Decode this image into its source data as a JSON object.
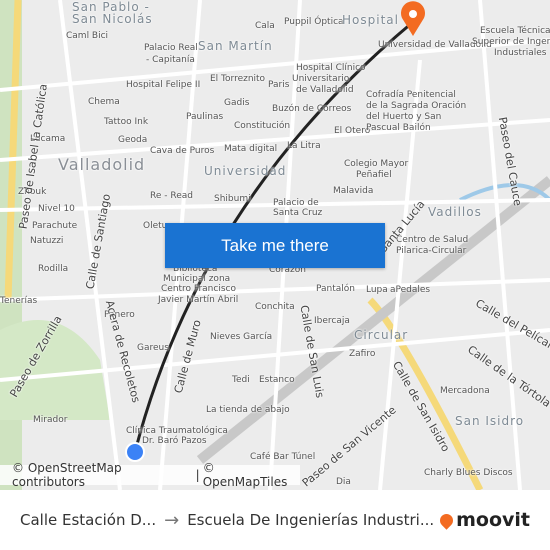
{
  "map": {
    "labels": [
      "San Pablo -",
      "San Nicolás",
      "Caml Bici",
      "Palacio Real",
      "- Capitanía",
      "San Martín",
      "Cala",
      "Puppil Óptica",
      "Hospital",
      "Hospital Felipe II",
      "El Torreznito",
      "Hospital Clínico",
      "Universitario",
      "de Valladolid",
      "Chema",
      "Gadis",
      "Paris",
      "Buzón de Correos",
      "Tattoo Ink",
      "Paulinas",
      "Constitución",
      "Lucama",
      "Geoda",
      "Cava de Puros",
      "Mata digital",
      "La Litra",
      "El Otero",
      "Valladolid",
      "Universidad",
      "Colegio Mayor",
      "Peñafiel",
      "Zhouk",
      "Re - Read",
      "Shibumi",
      "Malavida",
      "Nivel 10",
      "Palacio de",
      "Santa Cruz",
      "Parachute",
      "Oletu",
      "Natuzzi",
      "Vadillos",
      "Centro de Salud",
      "Pilarica-Circular",
      "Rodilla",
      "Biblioteca",
      "Municipal zona",
      "Centro Francisco",
      "Javier Martín Abril",
      "Corazón",
      "Pantalón",
      "Lupa",
      "aPedales",
      "Tenerías",
      "Panero",
      "Conchita",
      "Ibercaja",
      "Gareus",
      "Nieves García",
      "Circular",
      "Zafiro",
      "Tedi",
      "Estanco",
      "Mirador",
      "La tienda de abajo",
      "Clínica Traumatológica",
      "Dr. Baró Pazos",
      "Café Bar Túnel",
      "Mercadona",
      "San Isidro",
      "Charly Blues Discos",
      "Dia",
      "Universidad de Valladolid",
      "Escuela Técnica",
      "Superior de Ingenieros",
      "Industriales",
      "Cofradía Penitencial",
      "de la Sagrada Oración",
      "del Huerto y San",
      "Pascual Bailón"
    ],
    "streets": [
      "Paseo de Isabel la Católica",
      "Calle de Santiago",
      "Acera de Recoletos",
      "Paseo de Zorrilla",
      "Calle de Muro",
      "Calle de San Luis",
      "Calle de San Isidro",
      "Paseo de San Vicente",
      "Paseo del Cauce",
      "Calle de la Tórtola",
      "Calle del Pelícano",
      "Santa Lucía"
    ],
    "route_color": "#222222",
    "origin_color": "#3b82f6",
    "destination_color": "#f36b21"
  },
  "cta": {
    "label": "Take me there"
  },
  "attribution": {
    "osm": "© OpenStreetMap contributors",
    "tiles": "© OpenMapTiles",
    "separator": "|"
  },
  "footer": {
    "origin": "Calle Estación D...",
    "destination": "Escuela De Ingenierías Industri...",
    "brand": "moovit"
  }
}
